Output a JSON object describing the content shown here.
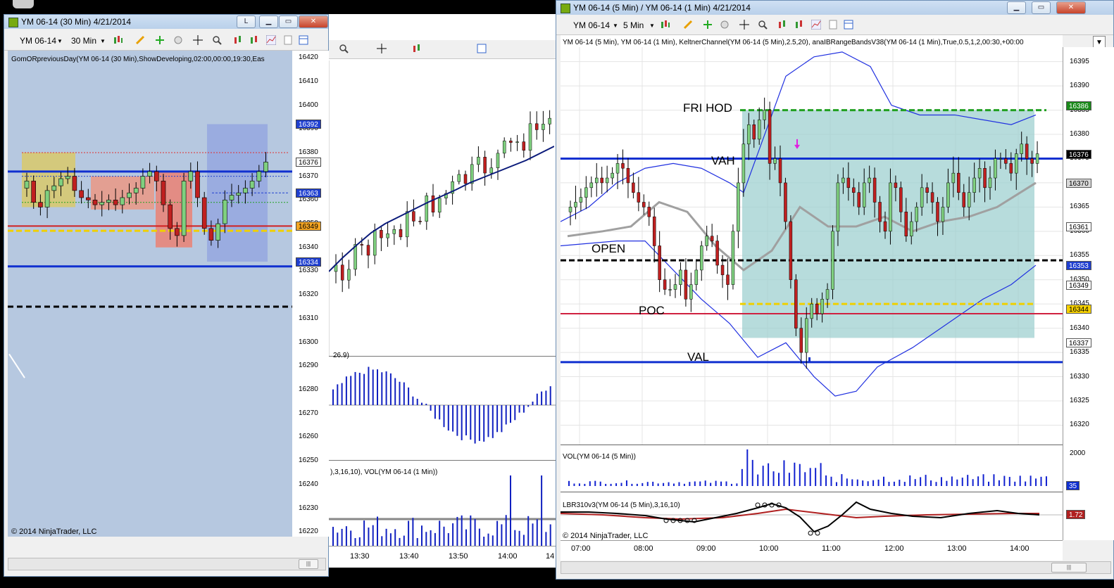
{
  "left_window": {
    "title": "YM 06-14 (30 Min)  4/21/2014",
    "btn_l": "L",
    "instrument": "YM 06-14",
    "period": "30 Min",
    "indicator_label": "GomORpreviousDay(YM 06-14 (30 Min),ShowDeveloping,02:00,00:00,19:30,Eas",
    "price_axis": [
      "16420",
      "16410",
      "16400",
      "16390",
      "16380",
      "16370",
      "16360",
      "16350",
      "16340",
      "16330",
      "16320",
      "16310",
      "16300",
      "16290",
      "16280",
      "16270",
      "16260",
      "16250",
      "16240",
      "16230",
      "16220"
    ],
    "tags": [
      {
        "value": "16392",
        "color": "#1f3fd0",
        "text": "#ffffff"
      },
      {
        "value": "16376",
        "color": "#ffffff",
        "text": "#000000"
      },
      {
        "value": "16363",
        "color": "#1f3fd0",
        "text": "#ffffff"
      },
      {
        "value": "16349",
        "color": "#f5a623",
        "text": "#000000"
      },
      {
        "value": "16334",
        "color": "#1f3fd0",
        "text": "#ffffff"
      }
    ],
    "copyright": "© 2014 NinjaTrader, LLC"
  },
  "middle_window": {
    "osc_label": "26.9)",
    "vol_label": "),3,16,10), VOL(YM 06-14 (1 Min))",
    "time_axis": [
      "13:30",
      "13:40",
      "13:50",
      "14:00",
      "14"
    ]
  },
  "right_window": {
    "title": "YM 06-14 (5 Min) / YM 06-14 (1 Min)  4/21/2014",
    "instrument": "YM 06-14",
    "period": "5 Min",
    "indicator_label": "YM 06-14 (5 Min), YM 06-14 (1 Min), KeltnerChannel(YM 06-14 (5 Min),2.5,20), anaIBRangeBandsV38(YM 06-14 (1 Min),True,0.5,1,2,00:30,+00:00",
    "levels": [
      "FRI HOD",
      "VAH",
      "OPEN",
      "POC",
      "VAL"
    ],
    "price_axis": [
      "16395",
      "16390",
      "16385",
      "16380",
      "16375",
      "16370",
      "16365",
      "16360",
      "16355",
      "16350",
      "16345",
      "16340",
      "16335",
      "16330",
      "16325",
      "16320"
    ],
    "tags": [
      {
        "value": "16386",
        "color": "#1a8a1a",
        "text": "#ffffff"
      },
      {
        "value": "16376",
        "color": "#000000",
        "text": "#ffffff"
      },
      {
        "value": "16370",
        "color": "#d9d9d9",
        "text": "#000000"
      },
      {
        "value": "16361",
        "color": "#ffffff",
        "text": "#000000"
      },
      {
        "value": "16353",
        "color": "#1f3fd0",
        "text": "#ffffff"
      },
      {
        "value": "16349",
        "color": "#ffffff",
        "text": "#000000"
      },
      {
        "value": "16344",
        "color": "#f5d000",
        "text": "#000000"
      },
      {
        "value": "16337",
        "color": "#ffffff",
        "text": "#000000"
      }
    ],
    "vol_label": "VOL(YM 06-14 (5 Min))",
    "vol_axis": "2000",
    "vol_tag": "35",
    "osc_label": "LBR310v3(YM 06-14 (5 Min),3,16,10)",
    "osc_tag": "1.72",
    "copyright": "© 2014 NinjaTrader, LLC",
    "time_axis": [
      "07:00",
      "08:00",
      "09:00",
      "10:00",
      "11:00",
      "12:00",
      "13:00",
      "14:00"
    ]
  },
  "chart_data": [
    {
      "type": "candlestick",
      "title": "YM 06-14 (30 Min)  4/21/2014",
      "ylim": [
        16218,
        16423
      ],
      "levels": {
        "blue_upper": 16372,
        "blue_lower": 16332,
        "red_solid": 16349,
        "yellow_dash": 16347,
        "black_dash": 16315,
        "dotted_blue": 16370,
        "dotted_green": 16359,
        "dotted_red": 16380
      }
    },
    {
      "type": "candlestick",
      "title": "YM 06-14 (5 Min) / YM 06-14 (1 Min)  4/21/2014",
      "ylim": [
        16316,
        16398
      ],
      "x": [
        "07:00",
        "08:00",
        "09:00",
        "10:00",
        "11:00",
        "12:00",
        "13:00",
        "14:00"
      ],
      "levels": {
        "FRI HOD": 16385,
        "VAH": 16375,
        "OPEN": 16354,
        "POC": 16343,
        "VAL": 16333
      },
      "ib_range": [
        16338,
        16385
      ]
    }
  ]
}
